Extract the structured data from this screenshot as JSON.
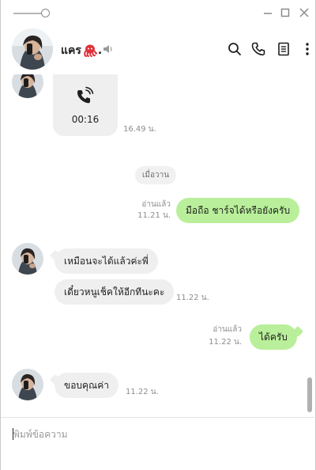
{
  "chat": {
    "name": "แคร",
    "input_placeholder": "พิมพ์ข้อความ"
  },
  "messages": {
    "call": {
      "duration": "00:16",
      "time": "16.49 น."
    },
    "date_divider": "เมื่อวาน",
    "out1": {
      "text": "มือถือ ชาร์จได้หรือยังครับ",
      "read": "อ่านแล้ว",
      "time": "11.21 น."
    },
    "in1": {
      "text": "เหมือนจะได้แล้วค่ะพี่"
    },
    "in2": {
      "text": "เดี๋ยวหนูเช็คให้อีกทีนะคะ",
      "time": "11.22 น."
    },
    "out2": {
      "text": "ได้ครับ",
      "read": "อ่านแล้ว",
      "time": "11.22 น."
    },
    "in3": {
      "text": "ขอบคุณค่า",
      "time": "11.22 น."
    }
  },
  "icons": {
    "name_emoji": "octopus-icon",
    "mute": "speaker-icon",
    "search": "search-icon",
    "call": "phone-icon",
    "notes": "notes-icon",
    "more": "more-vertical-icon"
  },
  "colors": {
    "outgoing_bubble": "#b9ef9a",
    "incoming_bubble": "#efefef",
    "meta_text": "#8d8d8d",
    "octopus": "#e0313b"
  }
}
